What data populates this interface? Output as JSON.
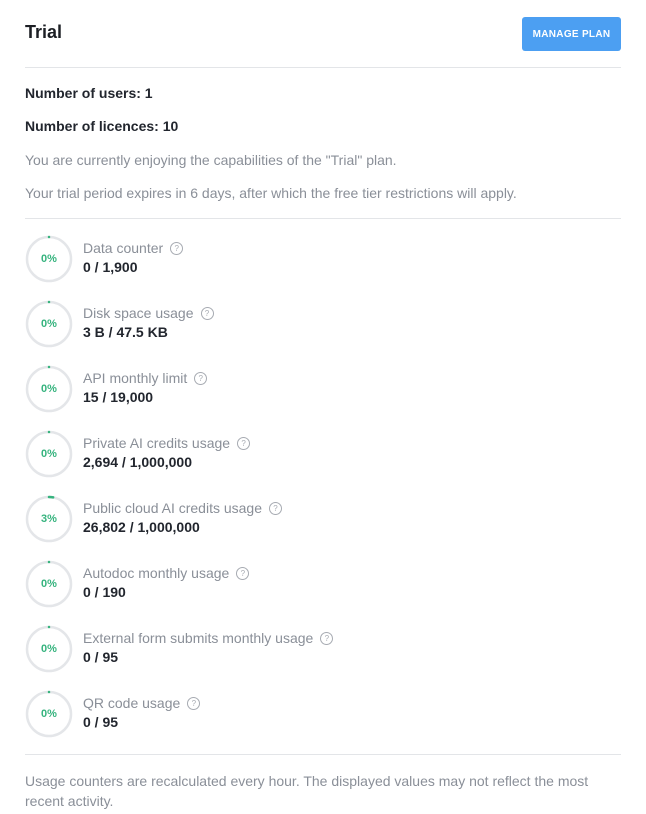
{
  "header": {
    "title": "Trial",
    "manage_button": "MANAGE PLAN"
  },
  "info": {
    "users": "Number of users: 1",
    "licences": "Number of licences: 10",
    "plan_text": "You are currently enjoying the capabilities of the \"Trial\" plan.",
    "expiry_text": "Your trial period expires in 6 days, after which the free tier restrictions will apply."
  },
  "colors": {
    "accent": "#4c9ff2",
    "progress": "#36b37e",
    "ring_track": "#e4e6e9"
  },
  "metrics": [
    {
      "label": "Data counter",
      "value": "0 / 1,900",
      "percent_label": "0%",
      "fraction": 0.0,
      "icon": "help-circle-icon"
    },
    {
      "label": "Disk space usage",
      "value": "3 B / 47.5 KB",
      "percent_label": "0%",
      "fraction": 0.0,
      "icon": "help-circle-icon"
    },
    {
      "label": "API monthly limit",
      "value": "15 / 19,000",
      "percent_label": "0%",
      "fraction": 0.0,
      "icon": "help-circle-icon"
    },
    {
      "label": "Private AI credits usage",
      "value": "2,694 / 1,000,000",
      "percent_label": "0%",
      "fraction": 0.0,
      "icon": "help-circle-icon"
    },
    {
      "label": "Public cloud AI credits usage",
      "value": "26,802 / 1,000,000",
      "percent_label": "3%",
      "fraction": 0.03,
      "icon": "help-circle-icon"
    },
    {
      "label": "Autodoc monthly usage",
      "value": "0 / 190",
      "percent_label": "0%",
      "fraction": 0.0,
      "icon": "help-circle-icon"
    },
    {
      "label": "External form submits monthly usage",
      "value": "0 / 95",
      "percent_label": "0%",
      "fraction": 0.0,
      "icon": "help-circle-icon"
    },
    {
      "label": "QR code usage",
      "value": "0 / 95",
      "percent_label": "0%",
      "fraction": 0.0,
      "icon": "help-circle-icon"
    }
  ],
  "footer": {
    "note": "Usage counters are recalculated every hour. The displayed values may not reflect the most recent activity."
  }
}
